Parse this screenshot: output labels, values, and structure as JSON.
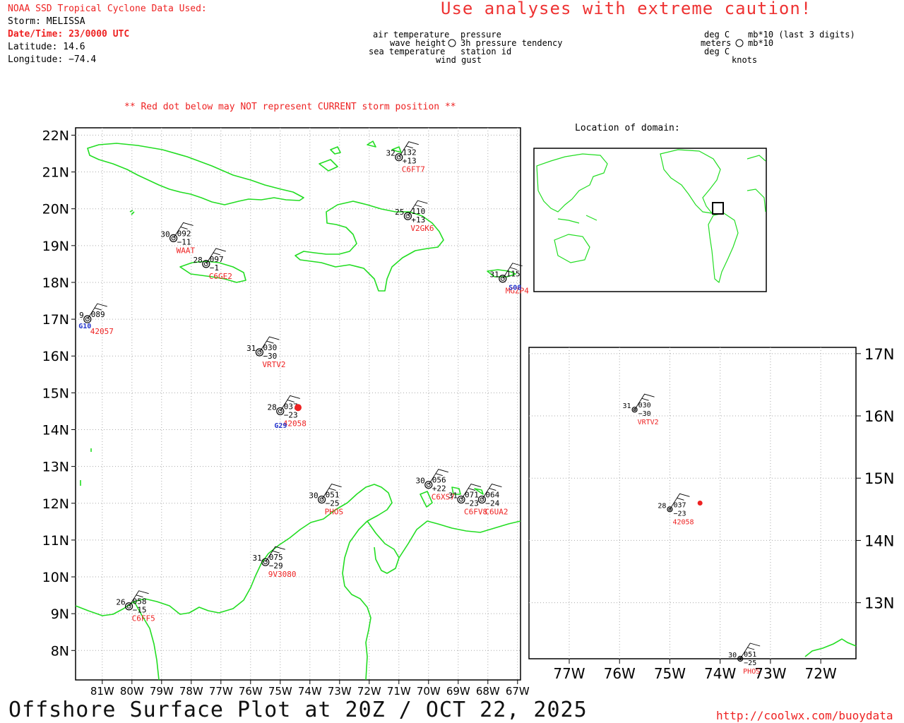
{
  "header": {
    "source_title": "NOAA SSD Tropical Cyclone Data Used:",
    "storm": "Storm: MELISSA",
    "datetime": "Date/Time: 23/0000 UTC",
    "latitude": "Latitude: 14.6",
    "longitude": "Longitude: −74.4",
    "caution": "Use analyses with extreme caution!"
  },
  "station_legend": {
    "left": {
      "air_temperature": "air temperature",
      "wave_height": "wave height",
      "sea_temperature": "sea temperature",
      "pressure": "pressure",
      "pressure_tendency": "3h pressure tendency",
      "station_id": "station id",
      "wind_gust": "wind gust"
    },
    "right": {
      "deg_c_top": "deg C",
      "meters": "meters",
      "deg_c_bottom": "deg C",
      "pressure_units": "mb*10 (last 3 digits)",
      "tendency_units": "mb*10",
      "knots": "knots"
    }
  },
  "note": "** Red dot below may NOT represent CURRENT storm position **",
  "inset_title": "Location of domain:",
  "footer": {
    "title": "Offshore Surface Plot at 20Z / OCT 22, 2025",
    "url": "http://coolwx.com/buoydata"
  },
  "main_map": {
    "lat_labels": [
      "22N",
      "21N",
      "20N",
      "19N",
      "18N",
      "17N",
      "16N",
      "15N",
      "14N",
      "13N",
      "12N",
      "11N",
      "10N",
      "9N",
      "8N"
    ],
    "lon_labels": [
      "81W",
      "80W",
      "79W",
      "78W",
      "77W",
      "76W",
      "75W",
      "74W",
      "73W",
      "72W",
      "71W",
      "70W",
      "69W",
      "68W",
      "67W"
    ]
  },
  "zoom_map": {
    "lat_labels": [
      "17N",
      "16N",
      "15N",
      "14N",
      "13N"
    ],
    "lon_labels": [
      "77W",
      "76W",
      "75W",
      "74W",
      "73W",
      "72W"
    ]
  },
  "storm_position": {
    "lat": 14.6,
    "lon": -74.4,
    "color": "#ee2222"
  },
  "stations": [
    {
      "id": "C6FT7",
      "temp": "32",
      "pres": "132",
      "tend": "+13",
      "lat": 21.4,
      "lon": -71.0
    },
    {
      "id": "V2GK6",
      "temp": "25",
      "pres": "110",
      "tend": "+13",
      "lat": 19.8,
      "lon": -70.7
    },
    {
      "id": "WAAT",
      "temp": "30",
      "pres": "092",
      "tend": "−11",
      "lat": 19.2,
      "lon": -78.6
    },
    {
      "id": "C6GE2",
      "temp": "28",
      "pres": "097",
      "tend": "−1",
      "lat": 18.5,
      "lon": -77.5
    },
    {
      "id": "42057",
      "temp": "9",
      "pres": "089",
      "tend": "",
      "lat": 17.0,
      "lon": -81.5
    },
    {
      "id": "VRTV2",
      "temp": "31",
      "pres": "030",
      "tend": "−30",
      "lat": 16.1,
      "lon": -75.7
    },
    {
      "id": "42058",
      "temp": "28",
      "pres": "037",
      "tend": "−23",
      "lat": 14.5,
      "lon": -75.0
    },
    {
      "id": "PHOS",
      "temp": "30",
      "pres": "051",
      "tend": "−25",
      "lat": 12.1,
      "lon": -73.6
    },
    {
      "id": "C6XS7",
      "temp": "30",
      "pres": "056",
      "tend": "+22",
      "lat": 12.5,
      "lon": -70.0
    },
    {
      "id": "C6FV8",
      "temp": "31",
      "pres": "071",
      "tend": "−23",
      "lat": 12.1,
      "lon": -68.9
    },
    {
      "id": "C6UA2",
      "temp": "",
      "pres": "064",
      "tend": "−24",
      "lat": 12.1,
      "lon": -68.2
    },
    {
      "id": "9V3080",
      "temp": "31",
      "pres": "075",
      "tend": "−29",
      "lat": 10.4,
      "lon": -75.5
    },
    {
      "id": "C6FF5",
      "temp": "26",
      "pres": "058",
      "tend": "−15",
      "lat": 9.2,
      "lon": -80.1
    },
    {
      "id": "MGZP4",
      "temp": "31",
      "pres": "115",
      "tend": "",
      "lat": 18.1,
      "lon": -67.5
    }
  ],
  "colors": {
    "coast": "#22dd22",
    "grid": "#999999",
    "text_red": "#ee2222",
    "text_blue": "#2233cc"
  }
}
